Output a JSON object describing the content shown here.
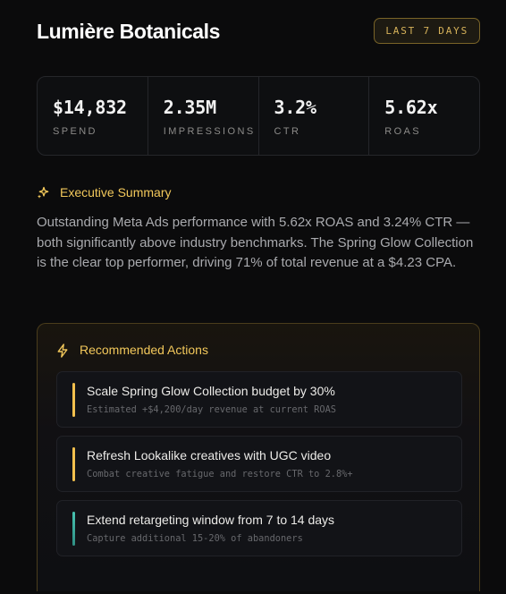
{
  "header": {
    "brand": "Lumière Botanicals",
    "date_range": "LAST 7 DAYS"
  },
  "metrics": [
    {
      "value": "$14,832",
      "label": "SPEND"
    },
    {
      "value": "2.35M",
      "label": "IMPRESSIONS"
    },
    {
      "value": "3.2%",
      "label": "CTR"
    },
    {
      "value": "5.62x",
      "label": "ROAS"
    }
  ],
  "summary": {
    "title": "Executive Summary",
    "icon": "sparkles-icon",
    "text": "Outstanding Meta Ads performance with 5.62x ROAS and 3.24% CTR — both significantly above industry benchmarks. The Spring Glow Collection is the clear top performer, driving 71% of total revenue at a $4.23 CPA."
  },
  "actions": {
    "title": "Recommended Actions",
    "icon": "lightning-bolt-icon",
    "items": [
      {
        "title": "Scale Spring Glow Collection budget by 30%",
        "subtitle": "Estimated +$4,200/day revenue at current ROAS",
        "accent": "#f2c04d"
      },
      {
        "title": "Refresh Lookalike creatives with UGC video",
        "subtitle": "Combat creative fatigue and restore CTR to 2.8%+",
        "accent": "#f2c04d"
      },
      {
        "title": "Extend retargeting window from 7 to 14 days",
        "subtitle": "Capture additional 15-20% of abandoners",
        "accent": "#3fb8a8"
      }
    ]
  },
  "colors": {
    "accent_gold": "#f2c85b",
    "accent_teal": "#3fb8a8",
    "background": "#0b0b0c"
  }
}
